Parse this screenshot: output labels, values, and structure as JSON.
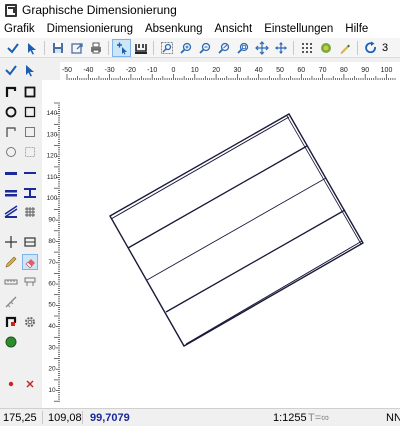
{
  "window": {
    "title": "Graphische Dimensionierung"
  },
  "menu": [
    "Grafik",
    "Dimensionierung",
    "Absenkung",
    "Ansicht",
    "Einstellungen",
    "Hilfe"
  ],
  "toolbar": {
    "icons": [
      "check-icon",
      "pointer-icon",
      "save-icon",
      "export-icon",
      "print-icon",
      "move-node-icon",
      "dimension-icon",
      "zoom-window-icon",
      "zoom-in-icon",
      "zoom-out-icon",
      "zoom-previous-icon",
      "zoom-all-icon",
      "pan-icon",
      "grid-icon",
      "layers-icon",
      "pencil-icon",
      "refresh-icon"
    ],
    "counter": "3"
  },
  "ruler": {
    "top_labels": [
      "-50",
      "-40",
      "-30",
      "-20",
      "-10",
      "0",
      "10",
      "20",
      "30",
      "40",
      "50",
      "60",
      "70",
      "80",
      "90",
      "100"
    ],
    "left_labels": [
      "140",
      "130",
      "120",
      "110",
      "100",
      "90",
      "80",
      "70",
      "60",
      "50",
      "40",
      "30",
      "20",
      "10"
    ]
  },
  "status": {
    "x": "175,25",
    "y": "109,08",
    "value": "99,7079",
    "scale": "1:1255",
    "extra": "T=∞",
    "right": "NN"
  },
  "colors": {
    "drawing": "#1a1a3a",
    "accent_blue": "#1a2a9a",
    "select_bg": "#cde6f7"
  }
}
